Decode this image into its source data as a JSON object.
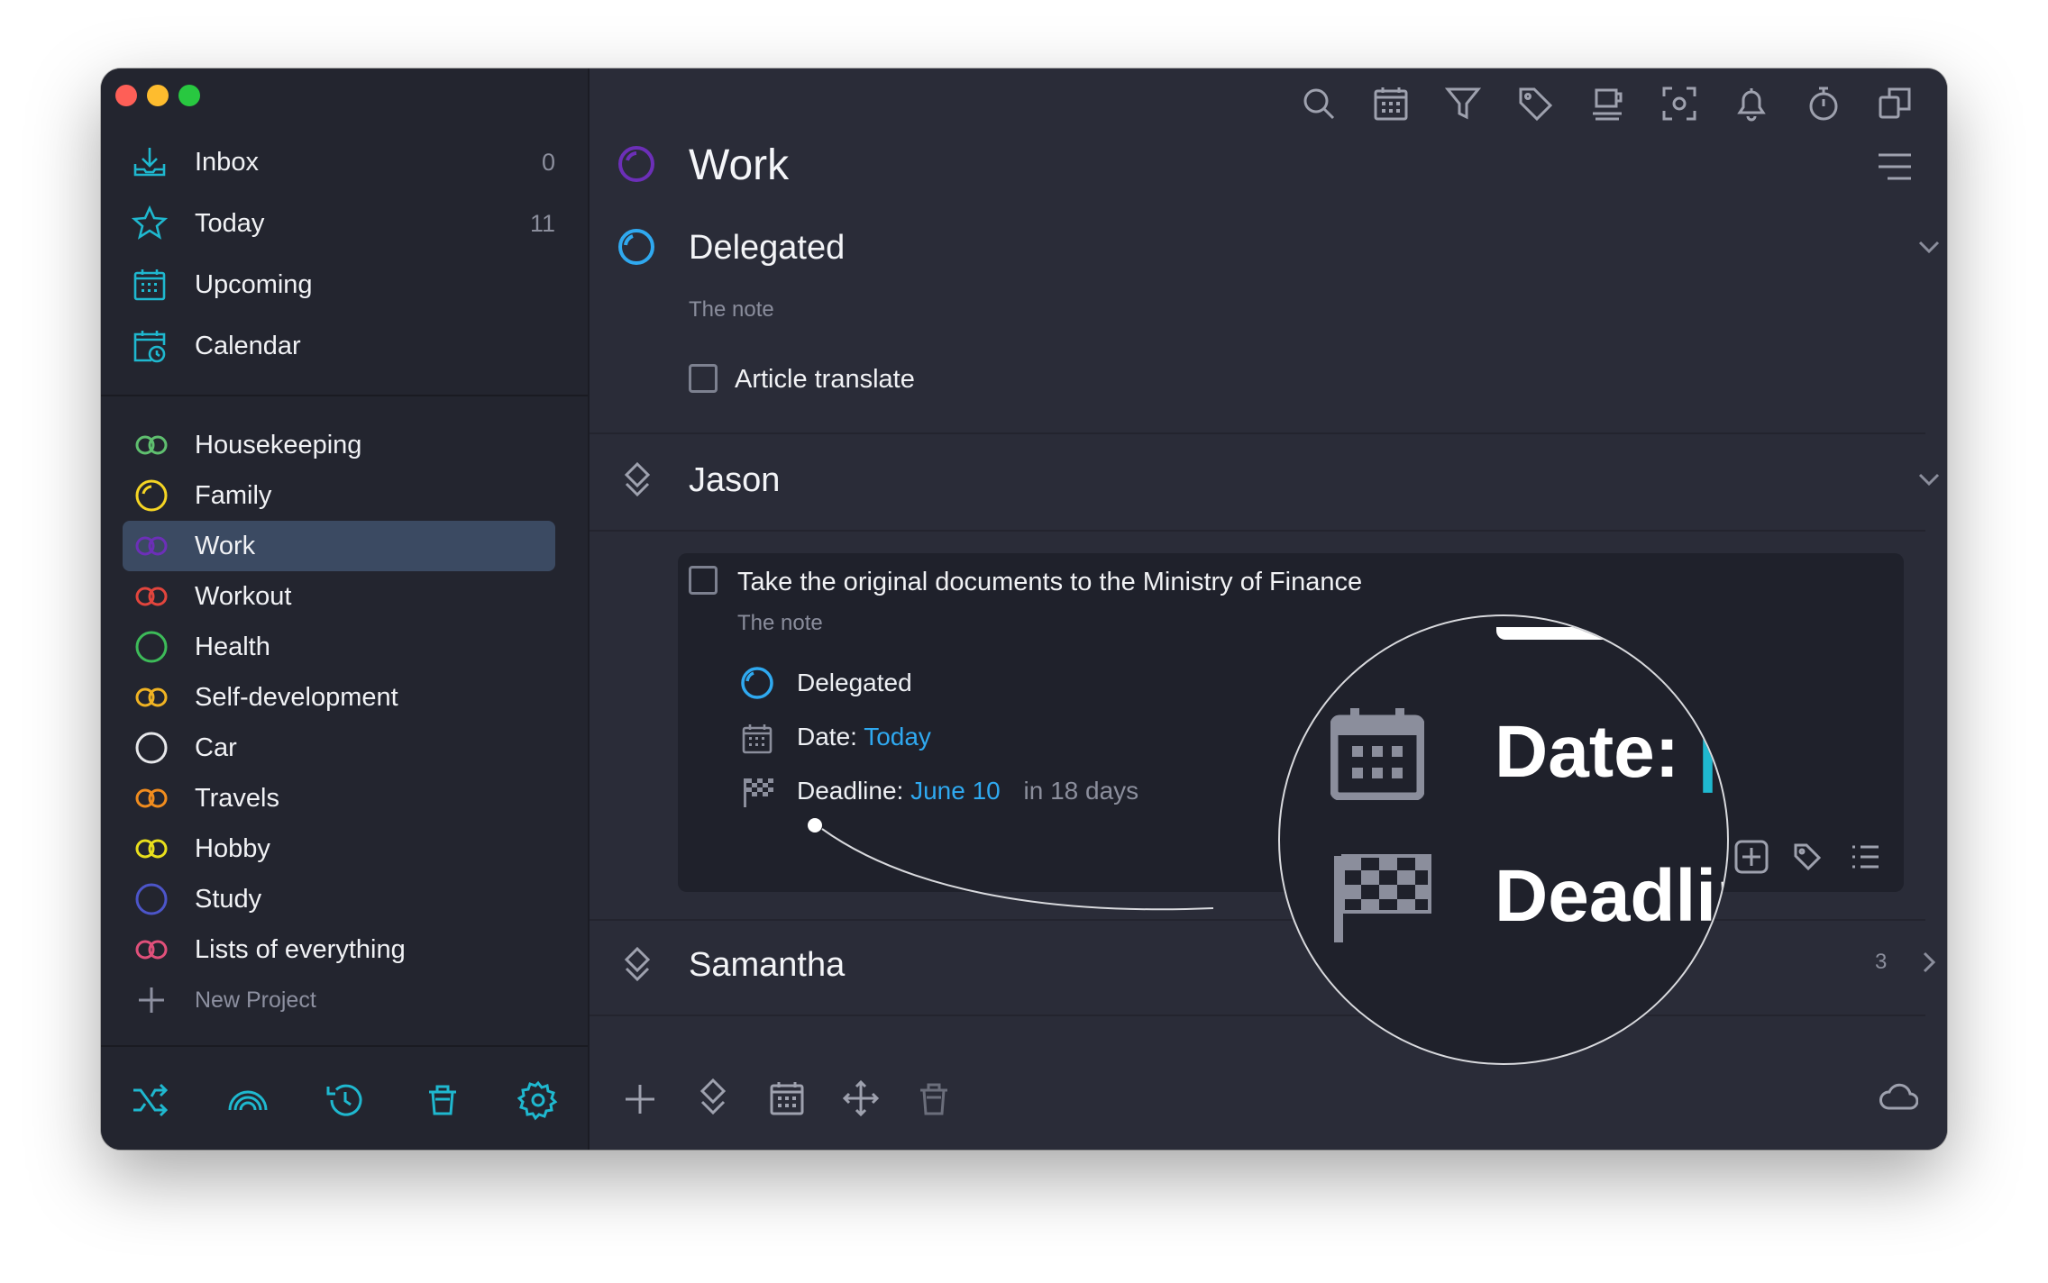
{
  "colors": {
    "accent": "#2fa9f0",
    "teal": "#1fb8cf",
    "sidebar_bg": "#23252f",
    "main_bg": "#2a2c38",
    "selected": "#3b4a62"
  },
  "sidebar": {
    "nav": [
      {
        "label": "Inbox",
        "count": "0",
        "icon": "inbox-icon"
      },
      {
        "label": "Today",
        "count": "11",
        "icon": "star-icon"
      },
      {
        "label": "Upcoming",
        "count": "",
        "icon": "calendar-grid-icon"
      },
      {
        "label": "Calendar",
        "count": "",
        "icon": "calendar-clock-icon"
      }
    ],
    "projects": [
      {
        "label": "Housekeeping",
        "color": "#5fbf6f",
        "icon": "double-circle-icon"
      },
      {
        "label": "Family",
        "color": "#f5d524",
        "icon": "progress-circle-icon"
      },
      {
        "label": "Work",
        "color": "#6c2fb8",
        "icon": "double-circle-icon"
      },
      {
        "label": "Workout",
        "color": "#e2453d",
        "icon": "double-circle-icon"
      },
      {
        "label": "Health",
        "color": "#3dbb59",
        "icon": "circle-icon"
      },
      {
        "label": "Self-development",
        "color": "#f0b323",
        "icon": "double-circle-icon"
      },
      {
        "label": "Car",
        "color": "#e6e7ea",
        "icon": "circle-icon"
      },
      {
        "label": "Travels",
        "color": "#f08c1e",
        "icon": "double-circle-icon"
      },
      {
        "label": "Hobby",
        "color": "#e9df1c",
        "icon": "double-circle-icon"
      },
      {
        "label": "Study",
        "color": "#4c55c9",
        "icon": "circle-icon"
      },
      {
        "label": "Lists of everything",
        "color": "#e0507a",
        "icon": "double-circle-icon"
      }
    ],
    "new_project": "New Project",
    "bottom_icons": [
      "shuffle-icon",
      "rainbow-icon",
      "history-icon",
      "trash-icon",
      "gear-icon"
    ]
  },
  "toolbar": {
    "icons": [
      "search-icon",
      "calendar-icon",
      "filter-icon",
      "tag-icon",
      "coffee-icon",
      "focus-icon",
      "bell-icon",
      "timer-icon",
      "copy-icon"
    ]
  },
  "main": {
    "title": "Work",
    "sections": {
      "delegated": {
        "title": "Delegated",
        "note": "The note",
        "task": "Article translate"
      },
      "jason": {
        "title": "Jason"
      },
      "samantha": {
        "title": "Samantha",
        "count": "3"
      }
    },
    "card": {
      "task": "Take the original documents to the Ministry of Finance",
      "note": "The note",
      "status": "Delegated",
      "date_label": "Date:",
      "date_value": "Today",
      "deadline_label": "Deadline:",
      "deadline_value": "June 10",
      "deadline_relative": "in 18 days"
    },
    "bottom_icons": [
      "plus-icon",
      "diamond-icon",
      "calendar-icon",
      "move-icon",
      "trash-icon",
      "cloud-icon"
    ]
  },
  "magnifier": {
    "date_text": "Date:",
    "deadline_text": "Deadlin"
  }
}
